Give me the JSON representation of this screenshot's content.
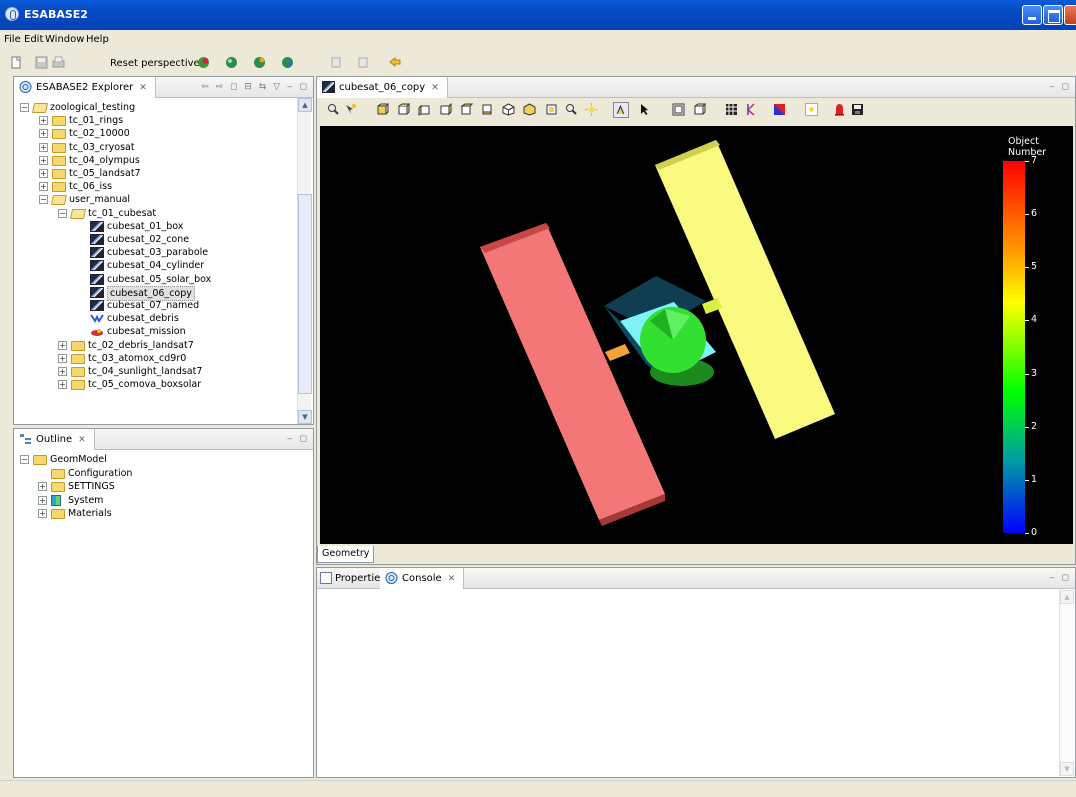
{
  "window": {
    "title": "ESABASE2"
  },
  "menu": [
    "File",
    "Edit",
    "Window",
    "Help"
  ],
  "toolbar": {
    "reset_label": "Reset perspective"
  },
  "explorer": {
    "tab_label": "ESABASE2 Explorer",
    "tree": [
      {
        "label": "zoological_testing",
        "depth": 0,
        "kind": "folder-open",
        "expander": "-"
      },
      {
        "label": "tc_01_rings",
        "depth": 1,
        "kind": "folder",
        "expander": "+"
      },
      {
        "label": "tc_02_10000",
        "depth": 1,
        "kind": "folder",
        "expander": "+"
      },
      {
        "label": "tc_03_cryosat",
        "depth": 1,
        "kind": "folder",
        "expander": "+"
      },
      {
        "label": "tc_04_olympus",
        "depth": 1,
        "kind": "folder",
        "expander": "+"
      },
      {
        "label": "tc_05_landsat7",
        "depth": 1,
        "kind": "folder",
        "expander": "+"
      },
      {
        "label": "tc_06_iss",
        "depth": 1,
        "kind": "folder",
        "expander": "+"
      },
      {
        "label": "user_manual",
        "depth": 1,
        "kind": "folder-open",
        "expander": "-"
      },
      {
        "label": "tc_01_cubesat",
        "depth": 2,
        "kind": "folder-open",
        "expander": "-"
      },
      {
        "label": "cubesat_01_box",
        "depth": 3,
        "kind": "model",
        "expander": ""
      },
      {
        "label": "cubesat_02_cone",
        "depth": 3,
        "kind": "model",
        "expander": ""
      },
      {
        "label": "cubesat_03_parabole",
        "depth": 3,
        "kind": "model",
        "expander": ""
      },
      {
        "label": "cubesat_04_cylinder",
        "depth": 3,
        "kind": "model",
        "expander": ""
      },
      {
        "label": "cubesat_05_solar_box",
        "depth": 3,
        "kind": "model",
        "expander": ""
      },
      {
        "label": "cubesat_06_copy",
        "depth": 3,
        "kind": "model",
        "expander": "",
        "selected": true
      },
      {
        "label": "cubesat_07_named",
        "depth": 3,
        "kind": "model",
        "expander": ""
      },
      {
        "label": "cubesat_debris",
        "depth": 3,
        "kind": "debris",
        "expander": ""
      },
      {
        "label": "cubesat_mission",
        "depth": 3,
        "kind": "mission",
        "expander": ""
      },
      {
        "label": "tc_02_debris_landsat7",
        "depth": 2,
        "kind": "folder",
        "expander": "+"
      },
      {
        "label": "tc_03_atomox_cd9r0",
        "depth": 2,
        "kind": "folder",
        "expander": "+"
      },
      {
        "label": "tc_04_sunlight_landsat7",
        "depth": 2,
        "kind": "folder",
        "expander": "+"
      },
      {
        "label": "tc_05_comova_boxsolar",
        "depth": 2,
        "kind": "folder",
        "expander": "+"
      }
    ]
  },
  "outline": {
    "tab_label": "Outline",
    "tree": [
      {
        "label": "GeomModel",
        "depth": 0,
        "kind": "folder",
        "expander": "-"
      },
      {
        "label": "Configuration",
        "depth": 1,
        "kind": "folder",
        "expander": ""
      },
      {
        "label": "SETTINGS",
        "depth": 1,
        "kind": "folder",
        "expander": "+"
      },
      {
        "label": "System",
        "depth": 1,
        "kind": "system",
        "expander": "+"
      },
      {
        "label": "Materials",
        "depth": 1,
        "kind": "folder",
        "expander": "+"
      }
    ]
  },
  "editor": {
    "tab_label": "cubesat_06_copy",
    "bottom_tab": "Geometry",
    "legend": {
      "title": "Object Number",
      "ticks": [
        "7",
        "6",
        "5",
        "4",
        "3",
        "2",
        "1",
        "0"
      ]
    }
  },
  "bottom": {
    "tabs": [
      "Properties",
      "Console"
    ],
    "active": "Console"
  },
  "colors": {
    "panel_red": "#f47777",
    "panel_yellow": "#fafa80",
    "cube": "#7df3f7",
    "dish": "#32e032"
  }
}
